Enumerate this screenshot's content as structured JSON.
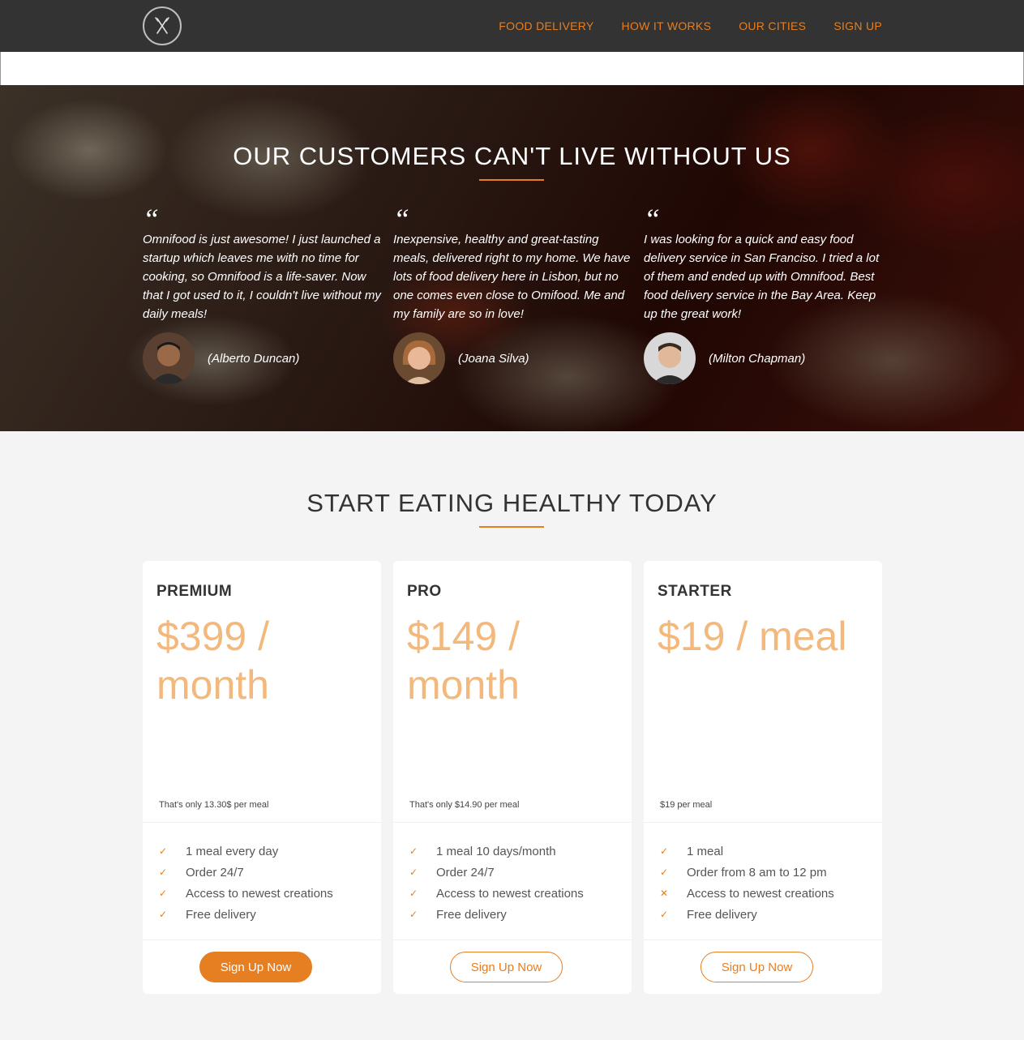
{
  "nav": {
    "logo_icon": "fork-knife-icon",
    "links": [
      "Food delivery",
      "How it works",
      "Our cities",
      "Sign up"
    ]
  },
  "testimonials": {
    "title": "Our customers can't live without us",
    "quote_mark": "“",
    "items": [
      {
        "text": "Omnifood is just awesome! I just launched a startup which leaves me with no time for cooking, so Omnifood is a life-saver. Now that I got used to it, I couldn't live without my daily meals!",
        "author": "(Alberto Duncan)"
      },
      {
        "text": "Inexpensive, healthy and great-tasting meals, delivered right to my home. We have lots of food delivery here in Lisbon, but no one comes even close to Omifood. Me and my family are so in love!",
        "author": "(Joana Silva)"
      },
      {
        "text": "I was looking for a quick and easy food delivery service in San Franciso. I tried a lot of them and ended up with Omnifood. Best food delivery service in the Bay Area. Keep up the great work!",
        "author": "(Milton Chapman)"
      }
    ]
  },
  "plans": {
    "title": "Start eating healthy today",
    "items": [
      {
        "name": "Premium",
        "price": "$399 / month",
        "note": "That's only 13.30$ per meal",
        "features": [
          {
            "text": "1 meal every day",
            "icon": "✓"
          },
          {
            "text": "Order 24/7",
            "icon": "✓"
          },
          {
            "text": "Access to newest creations",
            "icon": "✓"
          },
          {
            "text": "Free delivery",
            "icon": "✓"
          }
        ],
        "button": "Sign Up Now"
      },
      {
        "name": "Pro",
        "price": "$149 / month",
        "note": "That's only $14.90 per meal",
        "features": [
          {
            "text": "1 meal 10 days/month",
            "icon": "✓"
          },
          {
            "text": "Order 24/7",
            "icon": "✓"
          },
          {
            "text": "Access to newest creations",
            "icon": "✓"
          },
          {
            "text": "Free delivery",
            "icon": "✓"
          }
        ],
        "button": "Sign Up Now"
      },
      {
        "name": "Starter",
        "price": "$19 / meal",
        "note": "$19 per meal",
        "features": [
          {
            "text": "1 meal",
            "icon": "✓"
          },
          {
            "text": "Order from 8 am to 12 pm",
            "icon": "✓"
          },
          {
            "text": "Access to newest creations",
            "icon": "✕"
          },
          {
            "text": "Free delivery",
            "icon": "✓"
          }
        ],
        "button": "Sign Up Now"
      }
    ]
  },
  "colors": {
    "accent": "#e67e22",
    "nav_bg": "#333333",
    "price": "#f3b87c"
  }
}
